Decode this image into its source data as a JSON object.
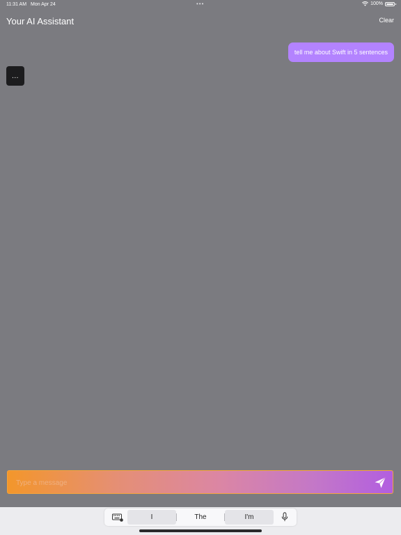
{
  "status_bar": {
    "time": "11:31 AM",
    "date": "Mon Apr 24",
    "battery": "100%"
  },
  "header": {
    "title": "Your AI Assistant",
    "clear_label": "Clear"
  },
  "messages": [
    {
      "role": "user",
      "text": "tell me about Swift in 5 sentences"
    },
    {
      "role": "assistant",
      "text": "..."
    }
  ],
  "input": {
    "placeholder": "Type a message",
    "value": ""
  },
  "keyboard": {
    "suggestions": [
      "I",
      "The",
      "I'm"
    ]
  },
  "icons": {
    "send": "send-icon",
    "keyboard": "keyboard-icon",
    "mic": "mic-icon",
    "wifi": "wifi-icon",
    "battery": "battery-icon"
  },
  "colors": {
    "user_bubble": "#b383ff",
    "background": "#7b7b80",
    "gradient_start": "#f3962b",
    "gradient_end": "#b25ee0"
  }
}
